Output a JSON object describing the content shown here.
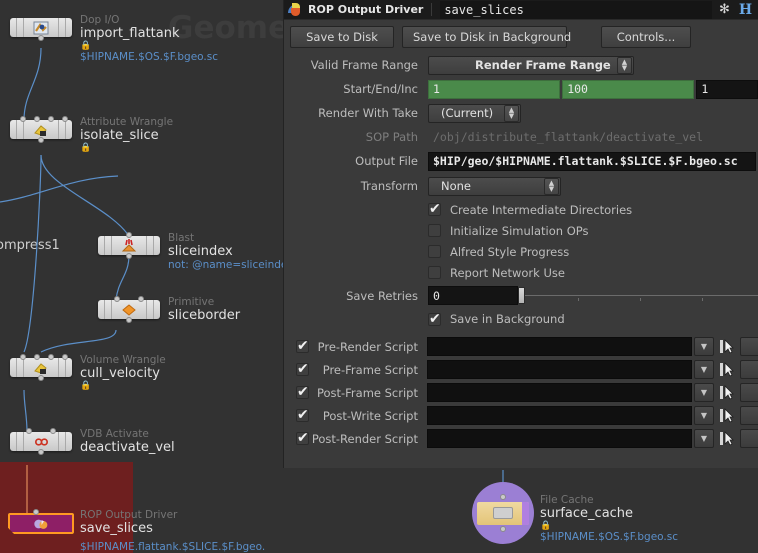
{
  "network": {
    "watermark": "Geometry",
    "stray_label": "ompress1",
    "nodes": [
      {
        "type": "Dop I/O",
        "name": "import_flattank",
        "locked": true,
        "hint": "$HIPNAME.$OS.$F.bgeo.sc",
        "icon": "dopio-icon"
      },
      {
        "type": "Attribute Wrangle",
        "name": "isolate_slice",
        "locked": true,
        "hint": "",
        "icon": "attribwrangle-icon"
      },
      {
        "type": "Blast",
        "name": "sliceindex",
        "locked": false,
        "hint": "not: @name=sliceindex",
        "icon": "blast-icon"
      },
      {
        "type": "Primitive",
        "name": "sliceborder",
        "locked": false,
        "hint": "",
        "icon": "primitive-icon"
      },
      {
        "type": "Volume Wrangle",
        "name": "cull_velocity",
        "locked": true,
        "hint": "",
        "icon": "volumewrangle-icon"
      },
      {
        "type": "VDB Activate",
        "name": "deactivate_vel",
        "locked": false,
        "hint": "",
        "icon": "vdbactivate-icon"
      },
      {
        "type": "ROP Output Driver",
        "name": "save_slices",
        "locked": false,
        "hint": "$HIPNAME.flattank.$SLICE.$F.bgeo.",
        "icon": "ropoutput-icon"
      },
      {
        "type": "File Cache",
        "name": "surface_cache",
        "locked": true,
        "hint": "$HIPNAME.$OS.$F.bgeo.sc",
        "icon": "filecache-icon"
      }
    ],
    "colors": {
      "background": "#323232",
      "selection_region": "#6e1f1f",
      "selected_node_fill": "#8e1f66",
      "selected_node_border": "#ff9a22",
      "wire": "#5b8fc9",
      "wire_selected": "#e08a5a",
      "filecache_circle": "#9b7fd4"
    }
  },
  "panel": {
    "header": {
      "node_type": "ROP Output Driver",
      "node_name": "save_slices",
      "gear_icon": "gear-icon",
      "help_icon": "houdini-help-icon"
    },
    "buttons": {
      "save_to_disk": "Save to Disk",
      "save_to_disk_background": "Save to Disk in Background",
      "controls": "Controls..."
    },
    "parameters": {
      "valid_frame_range": {
        "label": "Valid Frame Range",
        "value": "Render Frame Range"
      },
      "start_end_inc": {
        "label": "Start/End/Inc",
        "start": "1",
        "end": "100",
        "inc": "1"
      },
      "render_with_take": {
        "label": "Render With Take",
        "value": "(Current)"
      },
      "sop_path": {
        "label": "SOP Path",
        "value": "/obj/distribute_flattank/deactivate_vel"
      },
      "output_file": {
        "label": "Output File",
        "value": "$HIP/geo/$HIPNAME.flattank.$SLICE.$F.bgeo.sc"
      },
      "transform": {
        "label": "Transform",
        "value": "None"
      },
      "save_retries": {
        "label": "Save Retries",
        "value": "0"
      }
    },
    "checkboxes": [
      {
        "label": "Create Intermediate Directories",
        "checked": true
      },
      {
        "label": "Initialize Simulation OPs",
        "checked": false
      },
      {
        "label": "Alfred Style Progress",
        "checked": false
      },
      {
        "label": "Report Network Use",
        "checked": false
      }
    ],
    "save_in_background": {
      "label": "Save in Background",
      "checked": true
    },
    "scripts": [
      {
        "label": "Pre-Render Script",
        "value": "",
        "enabled": true
      },
      {
        "label": "Pre-Frame Script",
        "value": "",
        "enabled": true
      },
      {
        "label": "Post-Frame Script",
        "value": "",
        "enabled": true
      },
      {
        "label": "Post-Write Script",
        "value": "",
        "enabled": true
      },
      {
        "label": "Post-Render Script",
        "value": "",
        "enabled": true
      }
    ]
  }
}
